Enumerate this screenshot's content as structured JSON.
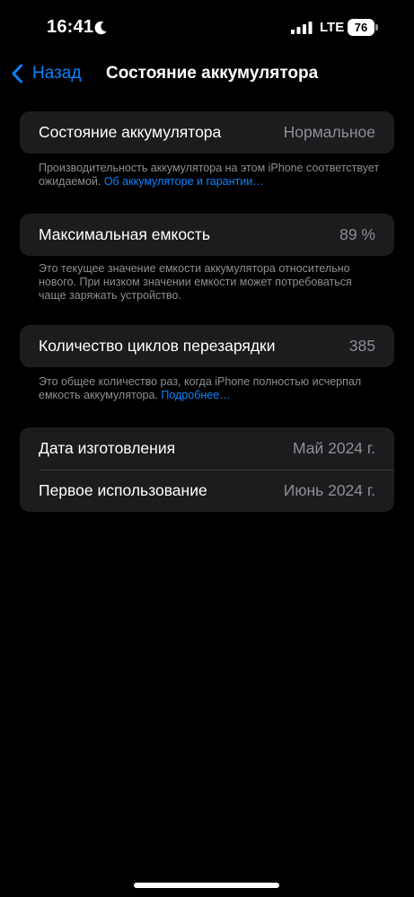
{
  "status_bar": {
    "time": "16:41",
    "network": "LTE",
    "battery_level": "76",
    "icons": [
      "moon-icon",
      "signal-icon",
      "battery-icon"
    ]
  },
  "nav": {
    "back_label": "Назад",
    "title": "Состояние аккумулятора"
  },
  "battery_state": {
    "label": "Состояние аккумулятора",
    "value": "Нормальное",
    "footer_text": "Производительность аккумулятора на этом iPhone соответствует ожидаемой. ",
    "footer_link": "Об аккумуляторе и гарантии…"
  },
  "max_capacity": {
    "label": "Максимальная емкость",
    "value": "89 %",
    "footer_text": "Это текущее значение емкости аккумулятора относительно нового. При низком значении емкости может потребоваться чаще заряжать устройство."
  },
  "cycle_count": {
    "label": "Количество циклов перезарядки",
    "value": "385",
    "footer_text": "Это общее количество раз, когда iPhone полностью исчерпал емкость аккумулятора. ",
    "footer_link": "Подробнее…"
  },
  "dates": {
    "manufacture_label": "Дата изготовления",
    "manufacture_value": "Май 2024 г.",
    "first_use_label": "Первое использование",
    "first_use_value": "Июнь 2024 г."
  },
  "colors": {
    "background": "#000000",
    "cell": "#1c1c1e",
    "accent": "#0a84ff",
    "secondary_text": "#8e8e93"
  }
}
